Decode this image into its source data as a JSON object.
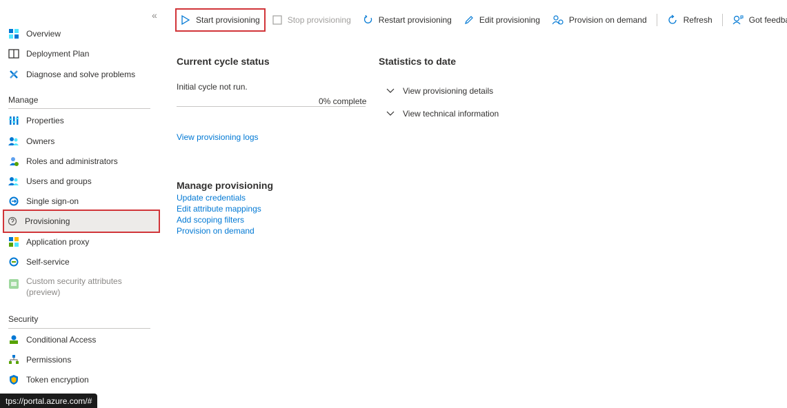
{
  "sidebar": {
    "collapse_glyph": "«",
    "top_items": [
      {
        "label": "Overview",
        "icon": "overview-icon"
      },
      {
        "label": "Deployment Plan",
        "icon": "book-icon"
      },
      {
        "label": "Diagnose and solve problems",
        "icon": "wrench-icon"
      }
    ],
    "manage_header": "Manage",
    "manage_items": [
      {
        "label": "Properties",
        "icon": "properties-icon"
      },
      {
        "label": "Owners",
        "icon": "owners-icon"
      },
      {
        "label": "Roles and administrators",
        "icon": "roles-icon"
      },
      {
        "label": "Users and groups",
        "icon": "users-icon"
      },
      {
        "label": "Single sign-on",
        "icon": "sso-icon"
      },
      {
        "label": "Provisioning",
        "icon": "provisioning-icon"
      },
      {
        "label": "Application proxy",
        "icon": "app-proxy-icon"
      },
      {
        "label": "Self-service",
        "icon": "self-service-icon"
      },
      {
        "label": "Custom security attributes (preview)",
        "label_line1": "Custom security attributes",
        "label_line2": "(preview)",
        "icon": "custom-attr-icon"
      }
    ],
    "security_header": "Security",
    "security_items": [
      {
        "label": "Conditional Access",
        "icon": "conditional-access-icon"
      },
      {
        "label": "Permissions",
        "icon": "permissions-icon"
      },
      {
        "label": "Token encryption",
        "icon": "shield-icon"
      }
    ]
  },
  "toolbar": {
    "start": "Start provisioning",
    "stop": "Stop provisioning",
    "restart": "Restart provisioning",
    "edit": "Edit provisioning",
    "on_demand": "Provision on demand",
    "refresh": "Refresh",
    "feedback": "Got feedback?"
  },
  "main": {
    "current_cycle_title": "Current cycle status",
    "cycle_message": "Initial cycle not run.",
    "progress_text": "0% complete",
    "progress_fraction": 0,
    "logs_link": "View provisioning logs",
    "stats_title": "Statistics to date",
    "expanders": [
      "View provisioning details",
      "View technical information"
    ],
    "manage_title": "Manage provisioning",
    "manage_links": [
      "Update credentials",
      "Edit attribute mappings",
      "Add scoping filters",
      "Provision on demand"
    ]
  },
  "statusbar": {
    "url": "tps://portal.azure.com/#"
  },
  "colors": {
    "accent": "#0078d4",
    "highlight": "#d13438",
    "text": "#323130",
    "disabled": "#a19f9d"
  }
}
